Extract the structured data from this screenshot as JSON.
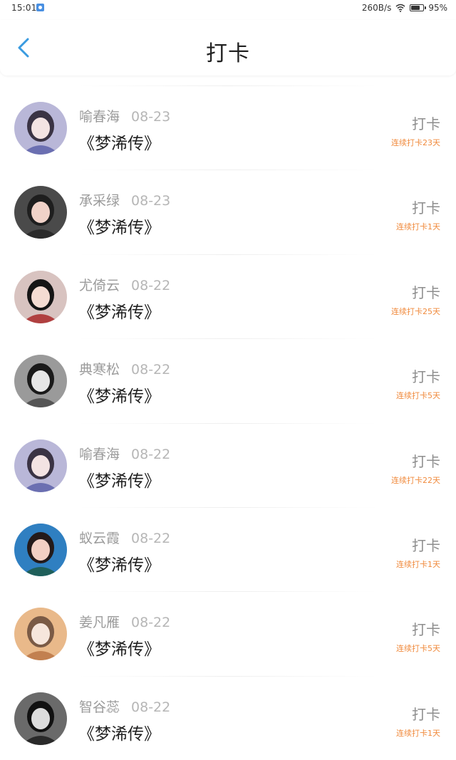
{
  "status_bar": {
    "time": "15:01",
    "net_speed": "260B/s",
    "battery": "95%"
  },
  "header": {
    "title": "打卡"
  },
  "items": [
    {
      "name": "喻春海",
      "date": "08-23",
      "book": "《梦浠传》",
      "action": "打卡",
      "streak": "连续打卡23天"
    },
    {
      "name": "承采绿",
      "date": "08-23",
      "book": "《梦浠传》",
      "action": "打卡",
      "streak": "连续打卡1天"
    },
    {
      "name": "尤倚云",
      "date": "08-22",
      "book": "《梦浠传》",
      "action": "打卡",
      "streak": "连续打卡25天"
    },
    {
      "name": "典寒松",
      "date": "08-22",
      "book": "《梦浠传》",
      "action": "打卡",
      "streak": "连续打卡5天"
    },
    {
      "name": "喻春海",
      "date": "08-22",
      "book": "《梦浠传》",
      "action": "打卡",
      "streak": "连续打卡22天"
    },
    {
      "name": "蚁云霞",
      "date": "08-22",
      "book": "《梦浠传》",
      "action": "打卡",
      "streak": "连续打卡1天"
    },
    {
      "name": "姜凡雁",
      "date": "08-22",
      "book": "《梦浠传》",
      "action": "打卡",
      "streak": "连续打卡5天"
    },
    {
      "name": "智谷蕊",
      "date": "08-22",
      "book": "《梦浠传》",
      "action": "打卡",
      "streak": "连续打卡1天"
    }
  ],
  "colors": {
    "accent_blue": "#3a9be0",
    "streak_orange": "#f08a3c"
  }
}
